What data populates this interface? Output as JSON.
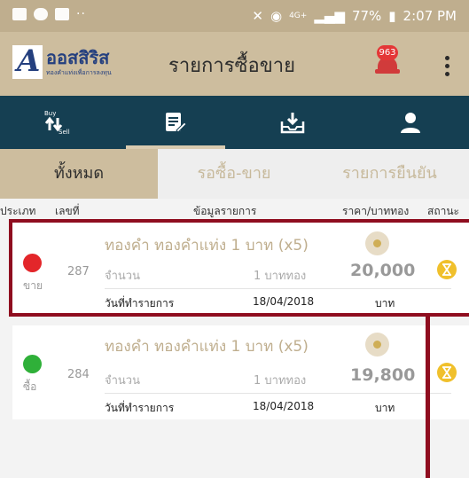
{
  "status_bar": {
    "time": "2:07 PM",
    "battery": "77%",
    "network": "4G+",
    "more_indicator": "··"
  },
  "app_header": {
    "logo_brand": "ออสสิริส",
    "logo_tagline": "ทองคำแท่งเพื่อการลงทุน",
    "title": "รายการซื้อขาย",
    "notification_count": "963"
  },
  "nav": {
    "tabs": [
      {
        "icon": "buy-sell-icon",
        "buy_text": "Buy",
        "sell_text": "Sell",
        "active": false
      },
      {
        "icon": "orders-list-icon",
        "active": true
      },
      {
        "icon": "inbox-download-icon",
        "active": false
      },
      {
        "icon": "user-icon",
        "active": false
      }
    ]
  },
  "filters": {
    "tabs": [
      "ทั้งหมด",
      "รอซื้อ-ขาย",
      "รายการยืนยัน"
    ],
    "active_index": 0
  },
  "columns": {
    "type": "ประเภท",
    "number": "เลขที่",
    "details": "ข้อมูลรายการ",
    "price": "ราคา/บาททอง",
    "status": "สถานะ"
  },
  "transactions": [
    {
      "side": "ขาย",
      "side_color": "#e3262a",
      "number": "287",
      "product": "ทองคำ  ทองคำแท่ง 1 บาท (x5)",
      "quantity_label": "จำนวน",
      "quantity": "1  บาททอง",
      "price": "20,000",
      "date_label": "วันที่ทำรายการ",
      "date": "18/04/2018",
      "unit": "บาท",
      "status_icon": "hourglass-icon"
    },
    {
      "side": "ซื้อ",
      "side_color": "#2fb039",
      "number": "284",
      "product": "ทองคำ  ทองคำแท่ง 1 บาท (x5)",
      "quantity_label": "จำนวน",
      "quantity": "1  บาททอง",
      "price": "19,800",
      "date_label": "วันที่ทำรายการ",
      "date": "18/04/2018",
      "unit": "บาท",
      "status_icon": "hourglass-icon"
    }
  ],
  "colors": {
    "header_gold": "#cdbd9e",
    "status_gold": "#bfae8e",
    "nav_navy": "#153f52",
    "brand_blue": "#25407f",
    "highlight_red": "#8f0d1f",
    "pending_yellow": "#f0c02c"
  }
}
